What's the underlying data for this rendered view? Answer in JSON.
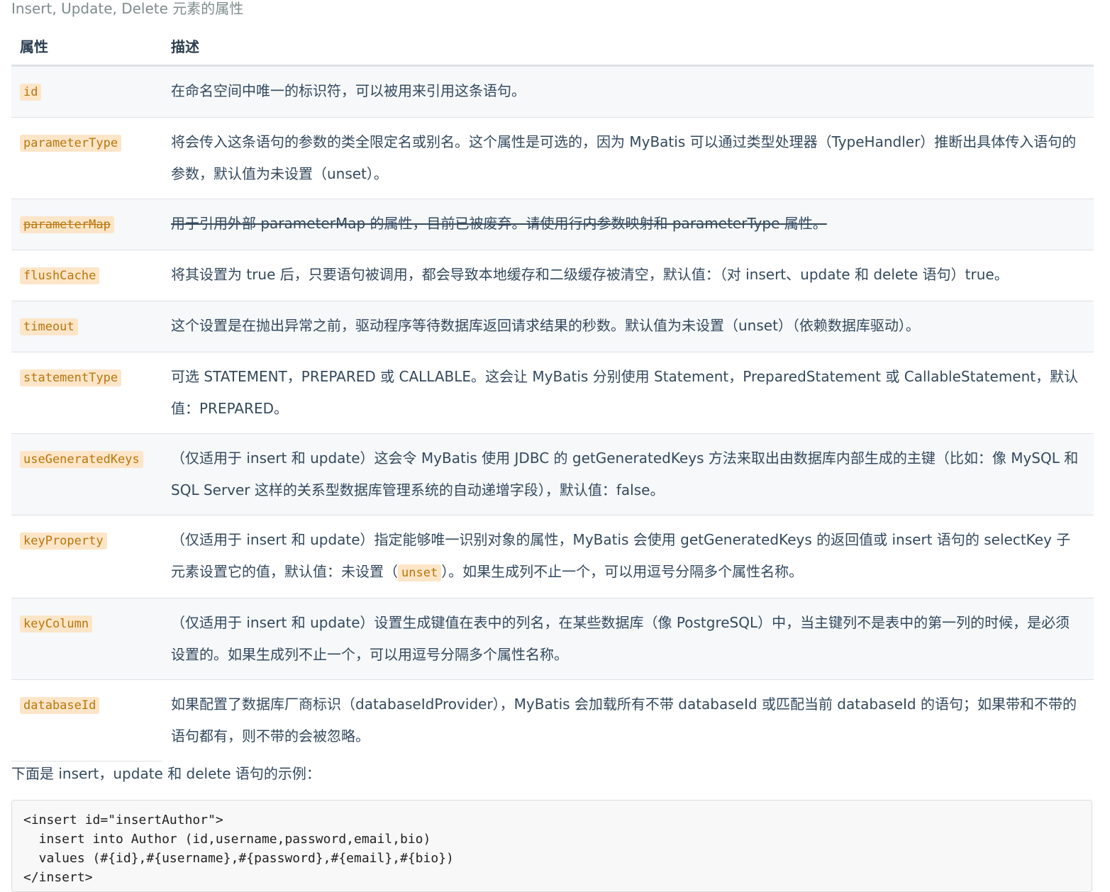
{
  "caption": "Insert, Update, Delete 元素的属性",
  "table": {
    "headers": {
      "attr": "属性",
      "desc": "描述"
    },
    "rows": [
      {
        "name": "id",
        "desc": "在命名空间中唯一的标识符，可以被用来引用这条语句。",
        "deprecated": false
      },
      {
        "name": "parameterType",
        "desc": "将会传入这条语句的参数的类全限定名或别名。这个属性是可选的，因为 MyBatis 可以通过类型处理器（TypeHandler）推断出具体传入语句的参数，默认值为未设置（unset）。",
        "deprecated": false
      },
      {
        "name": "parameterMap",
        "desc": "用于引用外部 parameterMap 的属性，目前已被废弃。请使用行内参数映射和 parameterType 属性。",
        "deprecated": true
      },
      {
        "name": "flushCache",
        "desc": "将其设置为 true 后，只要语句被调用，都会导致本地缓存和二级缓存被清空，默认值：（对 insert、update 和 delete 语句）true。",
        "deprecated": false
      },
      {
        "name": "timeout",
        "desc": "这个设置是在抛出异常之前，驱动程序等待数据库返回请求结果的秒数。默认值为未设置（unset）（依赖数据库驱动）。",
        "deprecated": false
      },
      {
        "name": "statementType",
        "desc": "可选 STATEMENT，PREPARED 或 CALLABLE。这会让 MyBatis 分别使用 Statement，PreparedStatement 或 CallableStatement，默认值：PREPARED。",
        "deprecated": false
      },
      {
        "name": "useGeneratedKeys",
        "desc": "（仅适用于 insert 和 update）这会令 MyBatis 使用 JDBC 的 getGeneratedKeys 方法来取出由数据库内部生成的主键（比如：像 MySQL 和 SQL Server 这样的关系型数据库管理系统的自动递增字段），默认值：false。",
        "deprecated": false
      },
      {
        "name": "keyProperty",
        "desc_before": "（仅适用于 insert 和 update）指定能够唯一识别对象的属性，MyBatis 会使用 getGeneratedKeys 的返回值或 insert 语句的 selectKey 子元素设置它的值，默认值：未设置（",
        "desc_code": "unset",
        "desc_after": "）。如果生成列不止一个，可以用逗号分隔多个属性名称。",
        "deprecated": false
      },
      {
        "name": "keyColumn",
        "desc": "（仅适用于 insert 和 update）设置生成键值在表中的列名，在某些数据库（像 PostgreSQL）中，当主键列不是表中的第一列的时候，是必须设置的。如果生成列不止一个，可以用逗号分隔多个属性名称。",
        "deprecated": false
      },
      {
        "name": "databaseId",
        "desc": "如果配置了数据库厂商标识（databaseIdProvider），MyBatis 会加载所有不带 databaseId 或匹配当前 databaseId 的语句；如果带和不带的语句都有，则不带的会被忽略。",
        "deprecated": false
      }
    ]
  },
  "intro": "下面是 insert，update 和 delete 语句的示例：",
  "code": "<insert id=\"insertAuthor\">\n  insert into Author (id,username,password,email,bio)\n  values (#{id},#{username},#{password},#{email},#{bio})\n</insert>"
}
